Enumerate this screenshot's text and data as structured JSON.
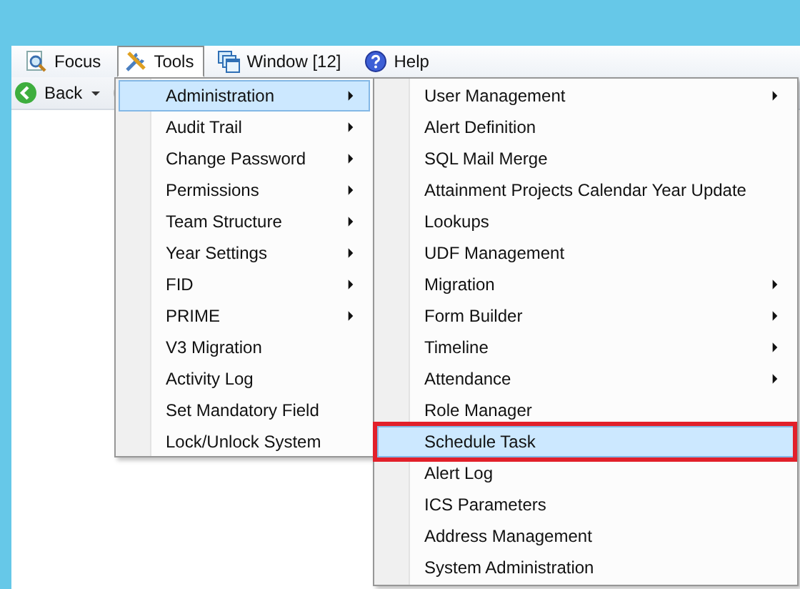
{
  "menu_bar": [
    {
      "label": "Focus",
      "open": false
    },
    {
      "label": "Tools",
      "open": true
    },
    {
      "label": "Window [12]",
      "open": false
    },
    {
      "label": "Help",
      "open": false
    }
  ],
  "toolbar": {
    "back_label": "Back"
  },
  "tools_menu": {
    "items": [
      {
        "label": "Administration",
        "has_submenu": true,
        "selected": true
      },
      {
        "label": "Audit Trail",
        "has_submenu": true,
        "selected": false
      },
      {
        "label": "Change Password",
        "has_submenu": true,
        "selected": false
      },
      {
        "label": "Permissions",
        "has_submenu": true,
        "selected": false
      },
      {
        "label": "Team Structure",
        "has_submenu": true,
        "selected": false
      },
      {
        "label": "Year Settings",
        "has_submenu": true,
        "selected": false
      },
      {
        "label": "FID",
        "has_submenu": true,
        "selected": false
      },
      {
        "label": "PRIME",
        "has_submenu": true,
        "selected": false
      },
      {
        "label": "V3 Migration",
        "has_submenu": false,
        "selected": false
      },
      {
        "label": "Activity Log",
        "has_submenu": false,
        "selected": false
      },
      {
        "label": "Set Mandatory Field",
        "has_submenu": false,
        "selected": false
      },
      {
        "label": "Lock/Unlock System",
        "has_submenu": false,
        "selected": false
      }
    ]
  },
  "administration_submenu": {
    "items": [
      {
        "label": "User Management",
        "has_submenu": true,
        "selected": false,
        "outlined": false
      },
      {
        "label": "Alert Definition",
        "has_submenu": false,
        "selected": false,
        "outlined": false
      },
      {
        "label": "SQL Mail Merge",
        "has_submenu": false,
        "selected": false,
        "outlined": false
      },
      {
        "label": "Attainment Projects Calendar Year Update",
        "has_submenu": false,
        "selected": false,
        "outlined": false
      },
      {
        "label": "Lookups",
        "has_submenu": false,
        "selected": false,
        "outlined": false
      },
      {
        "label": "UDF Management",
        "has_submenu": false,
        "selected": false,
        "outlined": false
      },
      {
        "label": "Migration",
        "has_submenu": true,
        "selected": false,
        "outlined": false
      },
      {
        "label": "Form Builder",
        "has_submenu": true,
        "selected": false,
        "outlined": false
      },
      {
        "label": "Timeline",
        "has_submenu": true,
        "selected": false,
        "outlined": false
      },
      {
        "label": "Attendance",
        "has_submenu": true,
        "selected": false,
        "outlined": false
      },
      {
        "label": "Role Manager",
        "has_submenu": false,
        "selected": false,
        "outlined": false
      },
      {
        "label": "Schedule Task",
        "has_submenu": false,
        "selected": true,
        "outlined": true
      },
      {
        "label": "Alert Log",
        "has_submenu": false,
        "selected": false,
        "outlined": false
      },
      {
        "label": "ICS Parameters",
        "has_submenu": false,
        "selected": false,
        "outlined": false
      },
      {
        "label": "Address Management",
        "has_submenu": false,
        "selected": false,
        "outlined": false
      },
      {
        "label": "System Administration",
        "has_submenu": false,
        "selected": false,
        "outlined": false
      }
    ]
  }
}
